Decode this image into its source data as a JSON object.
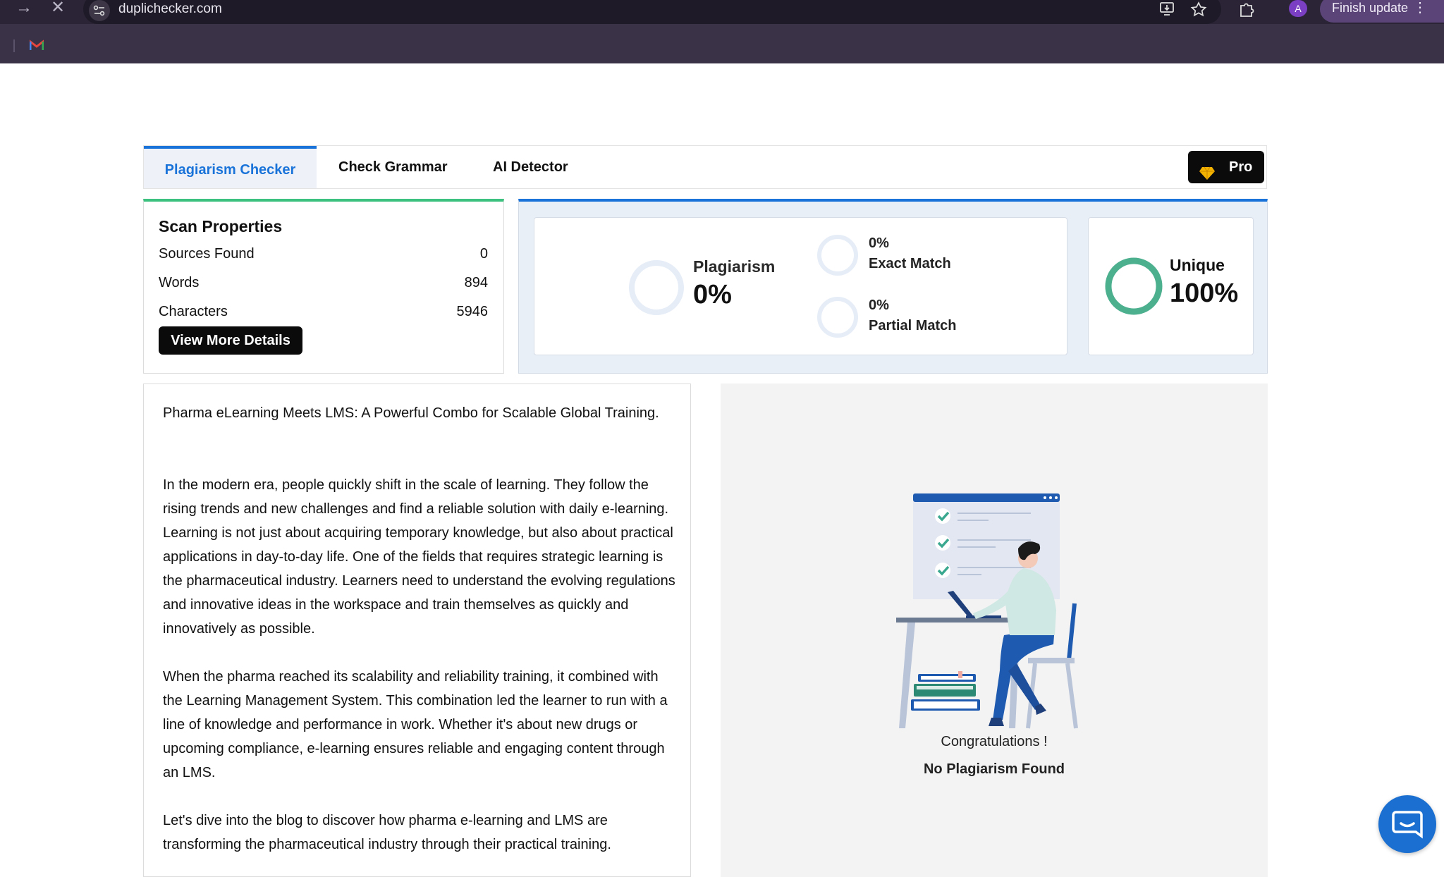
{
  "browser": {
    "url": "duplichecker.com",
    "profile_initial": "A",
    "finish_update_label": "Finish update"
  },
  "tabs": {
    "items": [
      "Plagiarism Checker",
      "Check Grammar",
      "AI Detector"
    ],
    "active_index": 0,
    "pro_label": "Pro"
  },
  "scan": {
    "title": "Scan Properties",
    "rows": [
      {
        "label": "Sources Found",
        "value": "0"
      },
      {
        "label": "Words",
        "value": "894"
      },
      {
        "label": "Characters",
        "value": "5946"
      }
    ],
    "details_button": "View More Details"
  },
  "results": {
    "plagiarism_label": "Plagiarism",
    "plagiarism_value": "0%",
    "exact_value": "0%",
    "exact_label": "Exact Match",
    "partial_value": "0%",
    "partial_label": "Partial Match",
    "unique_label": "Unique",
    "unique_value": "100%",
    "unique_fraction": 1.0
  },
  "document": {
    "paragraphs": [
      "Pharma eLearning Meets LMS: A Powerful Combo for Scalable Global Training.",
      "In the modern era, people quickly shift in the scale of learning. They follow the rising trends and new challenges and find a reliable solution with daily e-learning. Learning is not just about acquiring temporary knowledge, but also about practical applications in day-to-day life. One of the fields that requires strategic learning is the pharmaceutical industry. Learners need to understand the evolving regulations and innovative ideas in the workspace and train themselves as quickly and innovatively as possible.",
      "When the pharma reached its scalability and reliability training, it combined with the Learning Management System. This combination led the learner to run with a line of knowledge and performance in work. Whether it's about new drugs or upcoming compliance, e-learning ensures reliable and engaging content through an LMS.",
      "Let's dive into the blog to discover how pharma e-learning and LMS are transforming the pharmaceutical industry through their practical training."
    ]
  },
  "outcome": {
    "congrats": "Congratulations !",
    "message": "No Plagiarism Found"
  },
  "colors": {
    "accent_blue": "#1a73d9",
    "unique_green": "#4caf8e",
    "scan_green": "#3cc17f"
  }
}
